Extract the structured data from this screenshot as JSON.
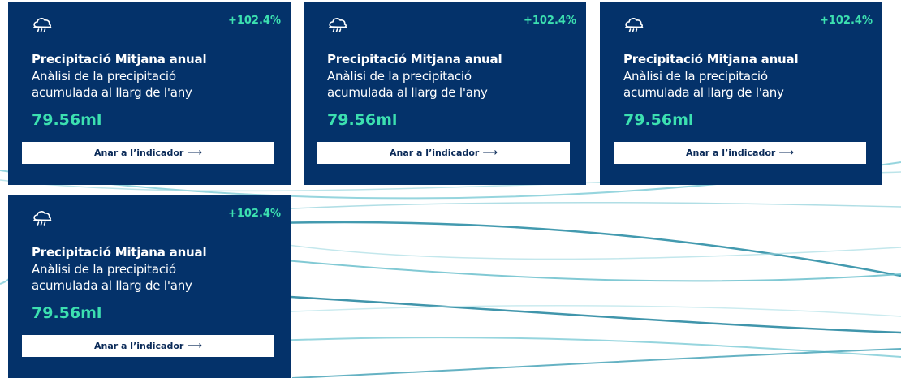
{
  "colors": {
    "card_bg": "#04326a",
    "accent": "#3ce0b0",
    "button_bg": "#ffffff",
    "button_text": "#0a2a58",
    "wave": "#5fb6c6"
  },
  "cards": [
    {
      "icon": "cloud-rain-icon",
      "change": "+102.4%",
      "title": "Precipitació Mitjana anual",
      "description": "Anàlisi de la precipitació acumulada al llarg de l'any",
      "value": "79.56ml",
      "cta_label": "Anar a l’indicador",
      "cta_arrow": "⟶"
    },
    {
      "icon": "cloud-rain-icon",
      "change": "+102.4%",
      "title": "Precipitació Mitjana anual",
      "description": "Anàlisi de la precipitació acumulada al llarg de l'any",
      "value": "79.56ml",
      "cta_label": "Anar a l’indicador",
      "cta_arrow": "⟶"
    },
    {
      "icon": "cloud-rain-icon",
      "change": "+102.4%",
      "title": "Precipitació Mitjana anual",
      "description": "Anàlisi de la precipitació acumulada al llarg de l'any",
      "value": "79.56ml",
      "cta_label": "Anar a l’indicador",
      "cta_arrow": "⟶"
    },
    {
      "icon": "cloud-rain-icon",
      "change": "+102.4%",
      "title": "Precipitació Mitjana anual",
      "description": "Anàlisi de la precipitació acumulada al llarg de l'any",
      "value": "79.56ml",
      "cta_label": "Anar a l’indicador",
      "cta_arrow": "⟶"
    }
  ]
}
